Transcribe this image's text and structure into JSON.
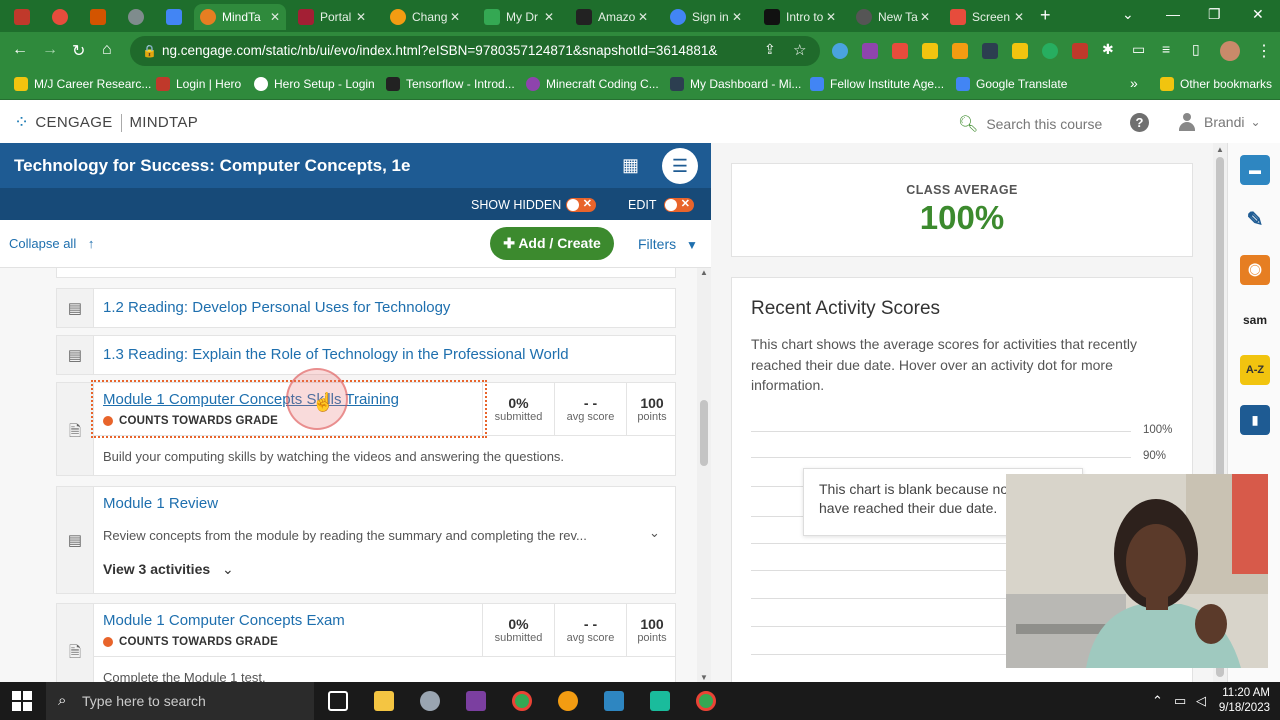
{
  "browser": {
    "tabs": [
      {
        "label": "",
        "color": "#c0392b"
      },
      {
        "label": "",
        "color": "#e74c3c"
      },
      {
        "label": "",
        "color": "#d35400"
      },
      {
        "label": "",
        "color": "#7f8c8d"
      },
      {
        "label": "",
        "color": "#4285f4"
      },
      {
        "label": "MindTa",
        "color": "#e67e22"
      },
      {
        "label": "Portal",
        "color": "#a31f34"
      },
      {
        "label": "Chang",
        "color": "#f39c12"
      },
      {
        "label": "My Dr",
        "color": "#34a853"
      },
      {
        "label": "Amazo",
        "color": "#222222"
      },
      {
        "label": "Sign in",
        "color": "#4285f4"
      },
      {
        "label": "Intro to",
        "color": "#111111"
      },
      {
        "label": "New Ta",
        "color": "#555555"
      },
      {
        "label": "Screen",
        "color": "#e74c3c"
      }
    ],
    "url": "ng.cengage.com/static/nb/ui/evo/index.html?eISBN=9780357124871&snapshotId=3614881&",
    "bookmarks": [
      {
        "label": "M/J Career Researc...",
        "color": "#f1c40f"
      },
      {
        "label": "Login | Hero",
        "color": "#c0392b"
      },
      {
        "label": "Hero Setup - Login",
        "color": "#ffffff"
      },
      {
        "label": "Tensorflow - Introd...",
        "color": "#222222"
      },
      {
        "label": "Minecraft Coding C...",
        "color": "#8e44ad"
      },
      {
        "label": "My Dashboard - Mi...",
        "color": "#2c3e50"
      },
      {
        "label": "Fellow Institute Age...",
        "color": "#4285f4"
      },
      {
        "label": "Google Translate",
        "color": "#4285f4"
      }
    ],
    "other_bookmarks": "Other bookmarks",
    "overflow": "»"
  },
  "header": {
    "brand": "CENGAGE",
    "product": "MINDTAP",
    "search_placeholder": "Search this course",
    "help": "?",
    "user_name": "Brandi"
  },
  "course": {
    "title": "Technology for Success: Computer Concepts, 1e",
    "show_hidden_label": "SHOW HIDDEN",
    "edit_label": "EDIT",
    "collapse_all": "Collapse all",
    "add_create": "Add / Create",
    "filters": "Filters",
    "items": [
      {
        "title": "1.2 Reading: Develop Personal Uses for Technology"
      },
      {
        "title": "1.3 Reading: Explain the Role of Technology in the Professional World"
      },
      {
        "title": "Module 1 Computer Concepts Skills Training",
        "badge": "COUNTS TOWARDS GRADE",
        "submitted": "0%",
        "submitted_label": "submitted",
        "avg_score": "- -",
        "avg_score_label": "avg score",
        "points": "100",
        "points_label": "points",
        "description": "Build your computing skills by watching the videos and answering the questions."
      },
      {
        "title": "Module 1 Review",
        "description": "Review concepts from the module by reading the summary and completing the rev...",
        "view_activities": "View 3 activities"
      },
      {
        "title": "Module 1 Computer Concepts Exam",
        "badge": "COUNTS TOWARDS GRADE",
        "submitted": "0%",
        "submitted_label": "submitted",
        "avg_score": "- -",
        "avg_score_label": "avg score",
        "points": "100",
        "points_label": "points",
        "description": "Complete the Module 1 test."
      }
    ]
  },
  "right": {
    "class_average_label": "CLASS AVERAGE",
    "class_average_value": "100%",
    "recent_title": "Recent Activity Scores",
    "recent_desc": "This chart shows the average scores for activities that recently reached their due date. Hover over an activity dot for more information.",
    "grid_labels": [
      "100%",
      "90%"
    ],
    "blank_message": "This chart is blank because no activities have reached their due date."
  },
  "taskbar": {
    "search_placeholder": "Type here to search",
    "time": "11:20 AM",
    "date": "9/18/2023"
  },
  "colors": {
    "chrome_green": "#2f8a3c",
    "course_blue": "#1e5b93",
    "link_blue": "#1e6fae",
    "accent_green": "#3c8a2e",
    "toggle_orange": "#e8642b"
  }
}
